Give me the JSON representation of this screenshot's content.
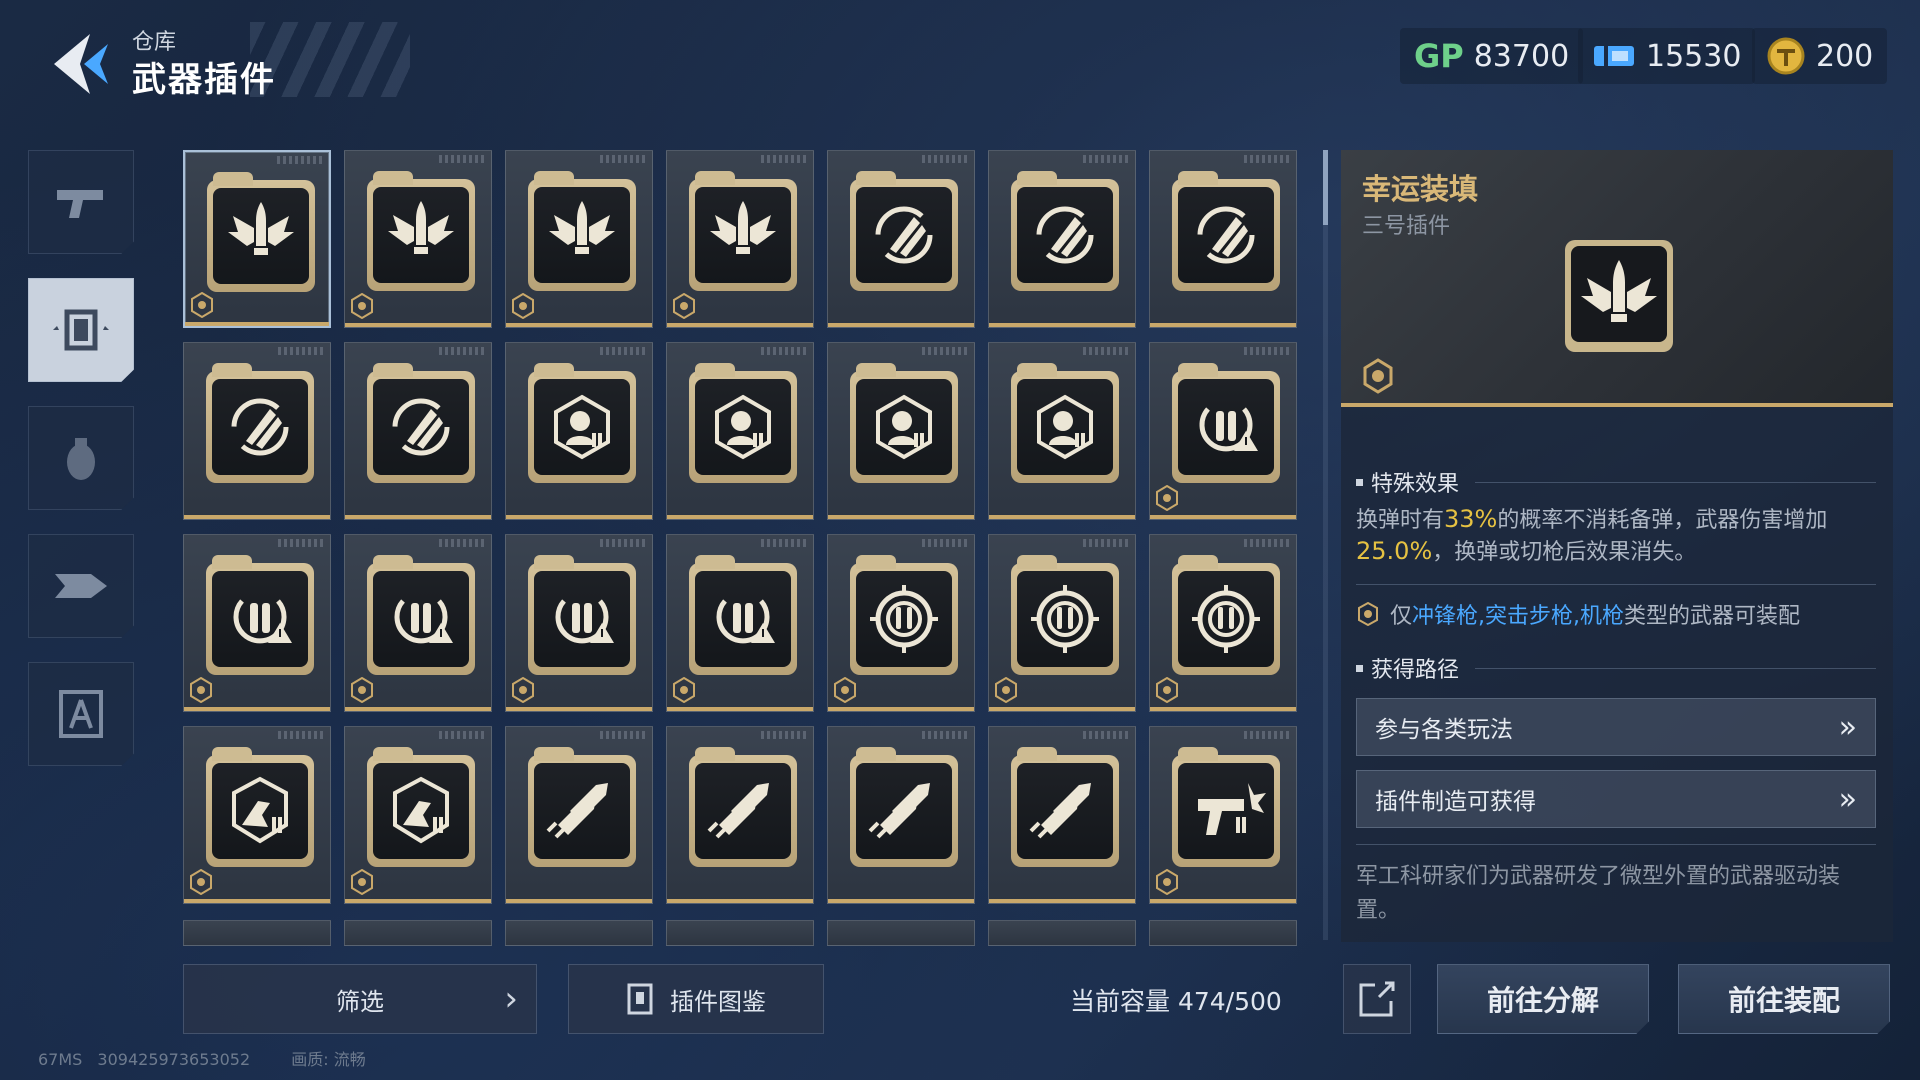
{
  "header": {
    "subtitle": "仓库",
    "title": "武器插件"
  },
  "currencies": [
    {
      "icon": "gp-icon",
      "value": "83700"
    },
    {
      "icon": "ticket-icon",
      "value": "15530"
    },
    {
      "icon": "gold-coin-icon",
      "value": "200"
    }
  ],
  "sidebar": [
    {
      "icon": "pistol-icon",
      "active": false
    },
    {
      "icon": "plugin-chip-icon",
      "active": true
    },
    {
      "icon": "grenade-icon",
      "active": false
    },
    {
      "icon": "drone-icon",
      "active": false
    },
    {
      "icon": "compass-badge-icon",
      "active": false
    }
  ],
  "grid": [
    {
      "icon": "winged-bullet-icon",
      "gear": true,
      "selected": true
    },
    {
      "icon": "winged-bullet-icon",
      "gear": true
    },
    {
      "icon": "winged-bullet-icon",
      "gear": true
    },
    {
      "icon": "winged-bullet-icon",
      "gear": true
    },
    {
      "icon": "reload-rockets-icon",
      "gear": false
    },
    {
      "icon": "reload-rockets-icon",
      "gear": false
    },
    {
      "icon": "reload-rockets-icon",
      "gear": false
    },
    {
      "icon": "reload-rockets-icon",
      "gear": false
    },
    {
      "icon": "reload-rockets-icon",
      "gear": false
    },
    {
      "icon": "target-head-ammo-icon",
      "gear": false
    },
    {
      "icon": "target-head-ammo-icon",
      "gear": false
    },
    {
      "icon": "target-head-ammo-icon",
      "gear": false
    },
    {
      "icon": "target-head-ammo-icon",
      "gear": false
    },
    {
      "icon": "ammo-warning-reload-icon",
      "gear": true
    },
    {
      "icon": "ammo-warning-reload-icon",
      "gear": true
    },
    {
      "icon": "ammo-warning-reload-icon",
      "gear": true
    },
    {
      "icon": "ammo-warning-reload-icon",
      "gear": true
    },
    {
      "icon": "ammo-warning-reload-icon",
      "gear": true
    },
    {
      "icon": "crosshair-ammo-icon",
      "gear": true
    },
    {
      "icon": "crosshair-ammo-icon",
      "gear": true
    },
    {
      "icon": "crosshair-ammo-icon",
      "gear": true
    },
    {
      "icon": "shield-hand-ammo-icon",
      "gear": true
    },
    {
      "icon": "shield-hand-ammo-icon",
      "gear": true
    },
    {
      "icon": "flying-bullets-icon",
      "gear": false
    },
    {
      "icon": "flying-bullets-icon",
      "gear": false
    },
    {
      "icon": "flying-bullets-icon",
      "gear": false
    },
    {
      "icon": "flying-bullets-icon",
      "gear": false
    },
    {
      "icon": "gun-burst-ammo-icon",
      "gear": true
    }
  ],
  "detail": {
    "name": "幸运装填",
    "slot": "三号插件",
    "effect_heading": "特殊效果",
    "effect_prefix": "换弹时有",
    "effect_pct": "33%",
    "effect_mid": "的概率不消耗备弹，武器伤害增加",
    "effect_dmg": "25.0%",
    "effect_suffix": "，换弹或切枪后效果消失。",
    "compat_prefix": "仅",
    "compat_types": "冲锋枪,突击步枪,机枪",
    "compat_suffix": "类型的武器可装配",
    "route_heading": "获得路径",
    "routes": [
      "参与各类玩法",
      "插件制造可获得"
    ],
    "flavor": "军工科研家们为武器研发了微型外置的武器驱动装置。"
  },
  "bottom": {
    "filter_label": "筛选",
    "codex_label": "插件图鉴",
    "capacity": "当前容量 474/500",
    "decompose_label": "前往分解",
    "equip_label": "前往装配"
  },
  "footer": {
    "ping": "67MS",
    "uid": "309425973653052",
    "quality": "画质: 流畅"
  }
}
